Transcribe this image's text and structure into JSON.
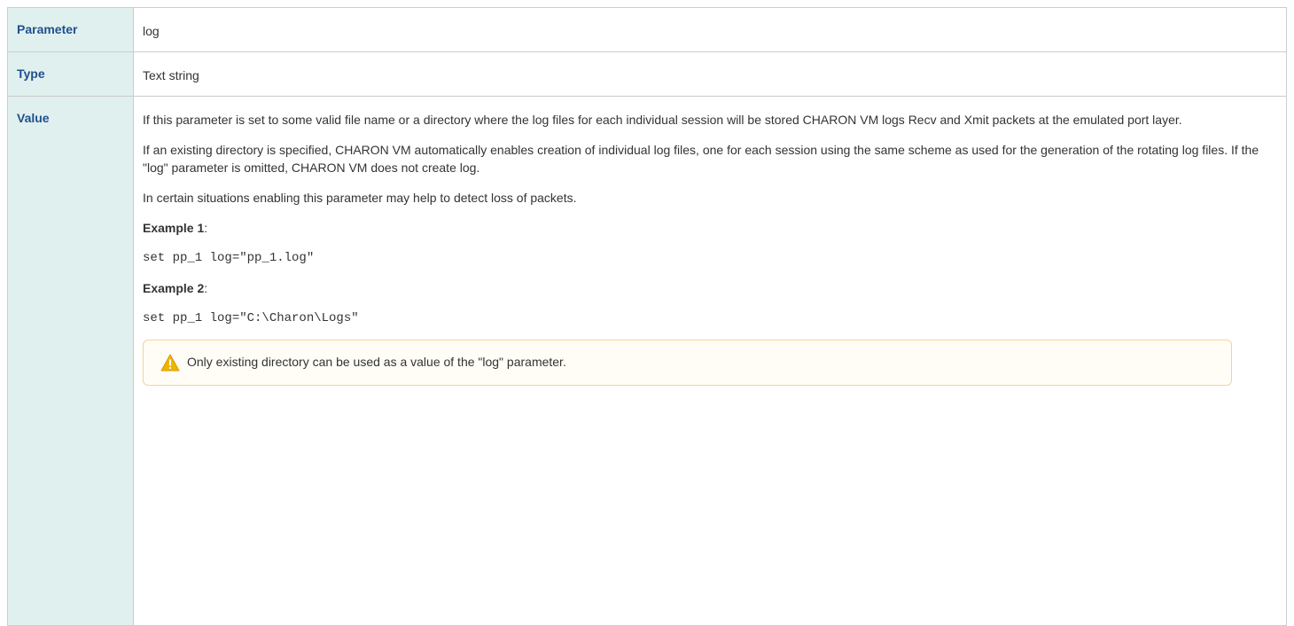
{
  "table": {
    "rows": [
      {
        "label": "Parameter",
        "value": "log"
      },
      {
        "label": "Type",
        "value": "Text string"
      },
      {
        "label": "Value",
        "paragraphs": [
          "If this parameter is set to some valid file name or a directory where the log files for each individual session will be stored CHARON VM logs Recv and Xmit packets at the emulated port layer.",
          "If an existing directory is specified, CHARON VM automatically enables creation of individual log files, one for each session using the same scheme as used for the generation of the rotating log files. If the \"log\" parameter is omitted, CHARON VM does not create log.",
          "In certain situations enabling this parameter may help to detect loss of packets."
        ],
        "examples": [
          {
            "title": "Example 1",
            "suffix": ":",
            "code": "set pp_1 log=\"pp_1.log\""
          },
          {
            "title": "Example 2",
            "suffix": ":",
            "code": "set pp_1 log=\"C:\\Charon\\Logs\""
          }
        ],
        "warning": {
          "icon": "warning-triangle-icon",
          "text": "Only existing directory can be used as a value of the \"log\" parameter."
        }
      }
    ]
  },
  "colors": {
    "header_bg": "#e0f0ee",
    "header_text": "#1f4f8f",
    "border": "#cccccc",
    "warning_bg": "#fffdf6",
    "warning_border": "#f0d59a",
    "warning_icon": "#f0b400"
  }
}
